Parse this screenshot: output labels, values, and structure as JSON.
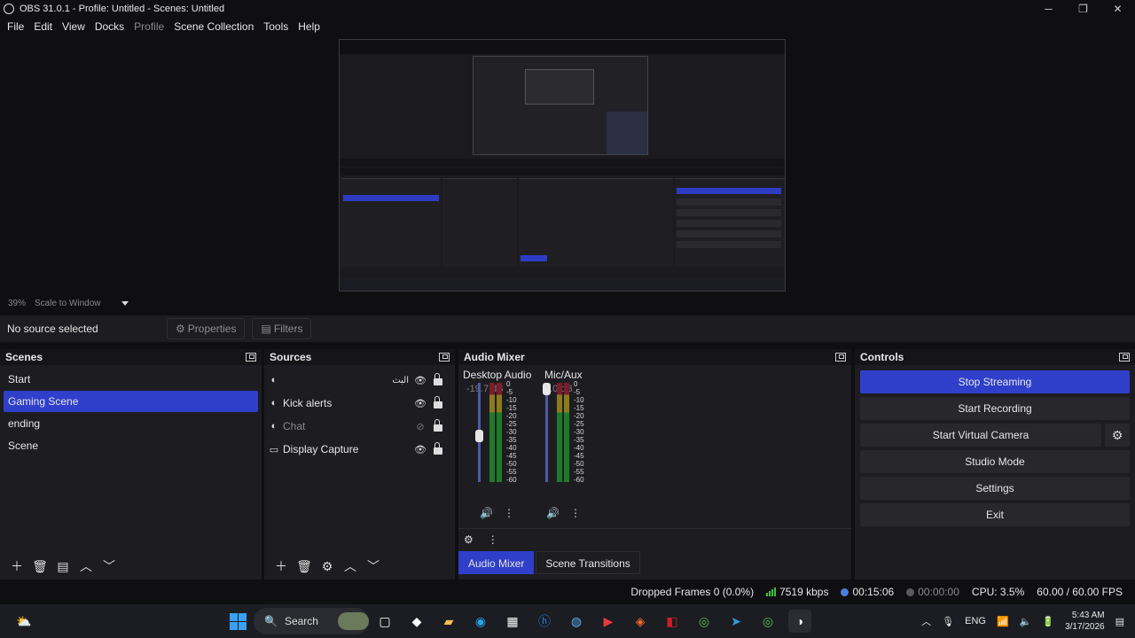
{
  "window": {
    "title": "OBS 31.0.1 - Profile: Untitled - Scenes: Untitled",
    "controls": [
      "─",
      "❐",
      "✕"
    ]
  },
  "menu": [
    "File",
    "Edit",
    "View",
    "Docks",
    "Profile",
    "Scene Collection",
    "Tools",
    "Help"
  ],
  "preview": {
    "zoom": "39%",
    "scale_mode": "Scale to Window"
  },
  "source_toolbar": {
    "no_source": "No source selected",
    "properties": "Properties",
    "filters": "Filters"
  },
  "scenes": {
    "title": "Scenes",
    "items": [
      "Start",
      "Gaming Scene",
      "ending",
      "Scene"
    ],
    "active_index": 1
  },
  "sources": {
    "title": "Sources",
    "items": [
      {
        "name": "",
        "extra": "البث",
        "visible": true
      },
      {
        "name": "Kick alerts",
        "visible": true
      },
      {
        "name": "Chat",
        "visible": false
      },
      {
        "name": "Display Capture",
        "visible": true
      }
    ]
  },
  "mixer": {
    "title": "Audio Mixer",
    "channels": [
      {
        "name": "Desktop Audio",
        "db": "-19.7 dB",
        "level": 0.49
      },
      {
        "name": "Mic/Aux",
        "db": "0.0 dB",
        "level": 1.0
      }
    ],
    "scale": [
      "0",
      "-5",
      "-10",
      "-15",
      "-20",
      "-25",
      "-30",
      "-35",
      "-40",
      "-45",
      "-50",
      "-55",
      "-60"
    ],
    "tabs": [
      "Audio Mixer",
      "Scene Transitions"
    ]
  },
  "controls": {
    "title": "Controls",
    "stop_streaming": "Stop Streaming",
    "start_recording": "Start Recording",
    "start_virtual_camera": "Start Virtual Camera",
    "studio_mode": "Studio Mode",
    "settings": "Settings",
    "exit": "Exit"
  },
  "status": {
    "dropped_frames": "Dropped Frames 0 (0.0%)",
    "bitrate": "7519 kbps",
    "stream_time": "00:15:06",
    "rec_time": "00:00:00",
    "cpu": "CPU: 3.5%",
    "fps": "60.00 / 60.00 FPS"
  },
  "taskbar": {
    "search": "Search",
    "lang": "ENG",
    "time": "5:43 AM",
    "date": "3/17/2026"
  },
  "colors": {
    "accent": "#2f3fc9",
    "background": "#1d1d21"
  }
}
